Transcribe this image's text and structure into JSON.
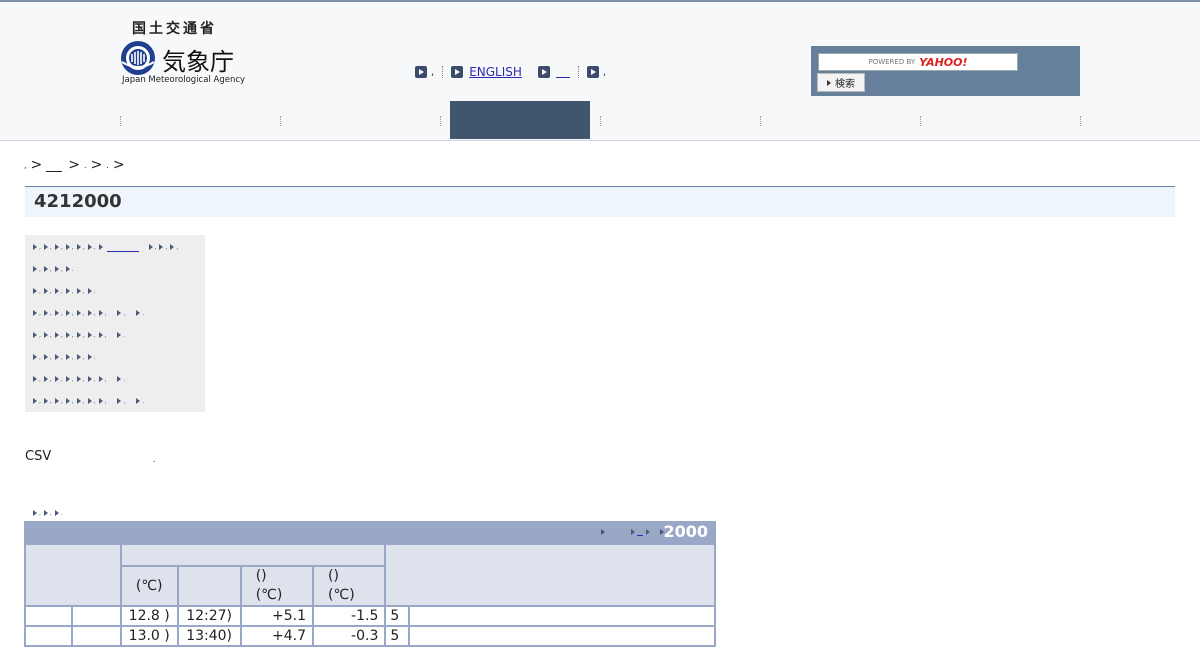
{
  "header": {
    "ministry": "国土交通省",
    "agency_jp": "気象庁",
    "agency_en": "Japan Meteorological Agency",
    "english_link": "ENGLISH",
    "search": {
      "powered_by": "POWERED BY",
      "provider": "YAHOO!",
      "button": "検索"
    }
  },
  "breadcrumb": {
    "separator": ">"
  },
  "page": {
    "title": "4212000"
  },
  "csv_label": "CSV",
  "table": {
    "year": "2000",
    "header": {
      "unit_c": "(℃)",
      "paren_a": "()",
      "unit_c_a": "(℃)",
      "paren_b": "()",
      "unit_c_b": "(℃)"
    },
    "rows": [
      {
        "temp": "12.8 )",
        "time": "12:27)",
        "diff": "+5.1",
        "min": "-1.5",
        "n": "5"
      },
      {
        "temp": "13.0 )",
        "time": "13:40)",
        "diff": "+4.7",
        "min": "-0.3",
        "n": "5"
      }
    ]
  },
  "colors": {
    "header_bg": "#f7f8fa",
    "nav_active": "#3f566e",
    "search_panel": "#667f9a",
    "title_bg": "#eef5fc",
    "table_bar": "#9aa8c8",
    "table_header": "#dde2ed",
    "link": "#2b2bb0"
  }
}
